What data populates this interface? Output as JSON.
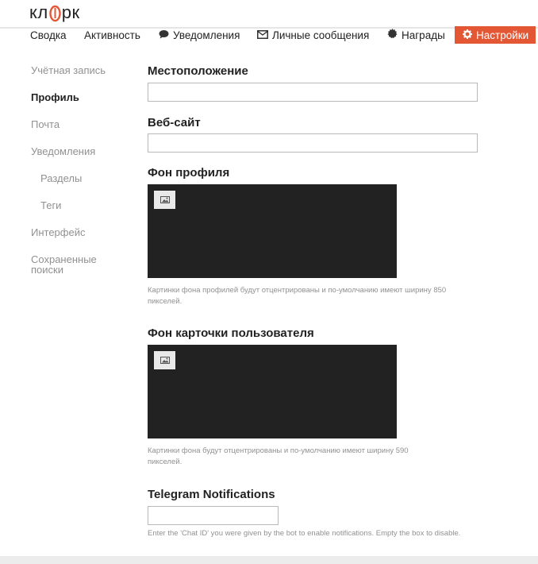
{
  "logo": {
    "part1": "кл",
    "part2": "рк",
    "icon": "paperclip-icon"
  },
  "nav": {
    "summary": "Сводка",
    "activity": "Активность",
    "notifications": "Уведомления",
    "messages": "Личные сообщения",
    "badges": "Награды",
    "preferences": "Настройки",
    "accent_color": "#e45735"
  },
  "sidebar": {
    "items": [
      {
        "label": "Учётная запись"
      },
      {
        "label": "Профиль"
      },
      {
        "label": "Почта"
      },
      {
        "label": "Уведомления"
      },
      {
        "label": "Разделы"
      },
      {
        "label": "Теги"
      },
      {
        "label": "Интерфейс"
      },
      {
        "label": "Сохраненные поиски"
      }
    ]
  },
  "main": {
    "location": {
      "label": "Местоположение",
      "value": ""
    },
    "website": {
      "label": "Веб-сайт",
      "value": ""
    },
    "profile_background": {
      "label": "Фон профиля",
      "hint": "Картинки фона профилей будут отцентрированы и по-умолчанию имеют ширину 850 пикселей."
    },
    "card_background": {
      "label": "Фон карточки пользователя",
      "hint": "Картинки фона будут отцентрированы и по-умолчанию имеют ширину 590 пикселей."
    },
    "telegram": {
      "label": "Telegram Notifications",
      "value": "",
      "hint": "Enter the 'Chat ID' you were given by the bot to enable notifications. Empty the box to disable."
    }
  }
}
